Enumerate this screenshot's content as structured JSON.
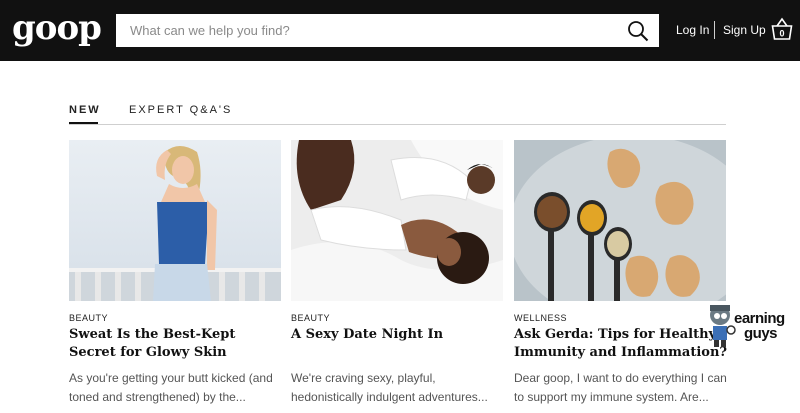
{
  "header": {
    "logo_text": "goop",
    "search_placeholder": "What can we help you find?",
    "login_label": "Log In",
    "signup_label": "Sign Up",
    "cart_count": "0",
    "icons": {
      "search": "search-icon",
      "cart": "basket-icon"
    }
  },
  "tabs": [
    {
      "label": "NEW",
      "active": true
    },
    {
      "label": "EXPERT Q&A'S",
      "active": false
    }
  ],
  "articles": [
    {
      "category": "BEAUTY",
      "title": "Sweat Is the Best-Kept Secret for Glowy Skin",
      "excerpt": "As you're getting your butt kicked (and toned and strengthened) by the..."
    },
    {
      "category": "BEAUTY",
      "title": "A Sexy Date Night In",
      "excerpt": "We're craving sexy, playful, hedonistically indulgent adventures..."
    },
    {
      "category": "WELLNESS",
      "title": "Ask Gerda: Tips for Healthy Immunity and Inflammation?",
      "excerpt": "Dear goop, I want to do everything I can to support my immune system. Are..."
    }
  ],
  "watermark": {
    "line1": "earning",
    "line2": "guys"
  },
  "colors": {
    "header_bg": "#111111",
    "text": "#111111",
    "muted": "#555555"
  }
}
